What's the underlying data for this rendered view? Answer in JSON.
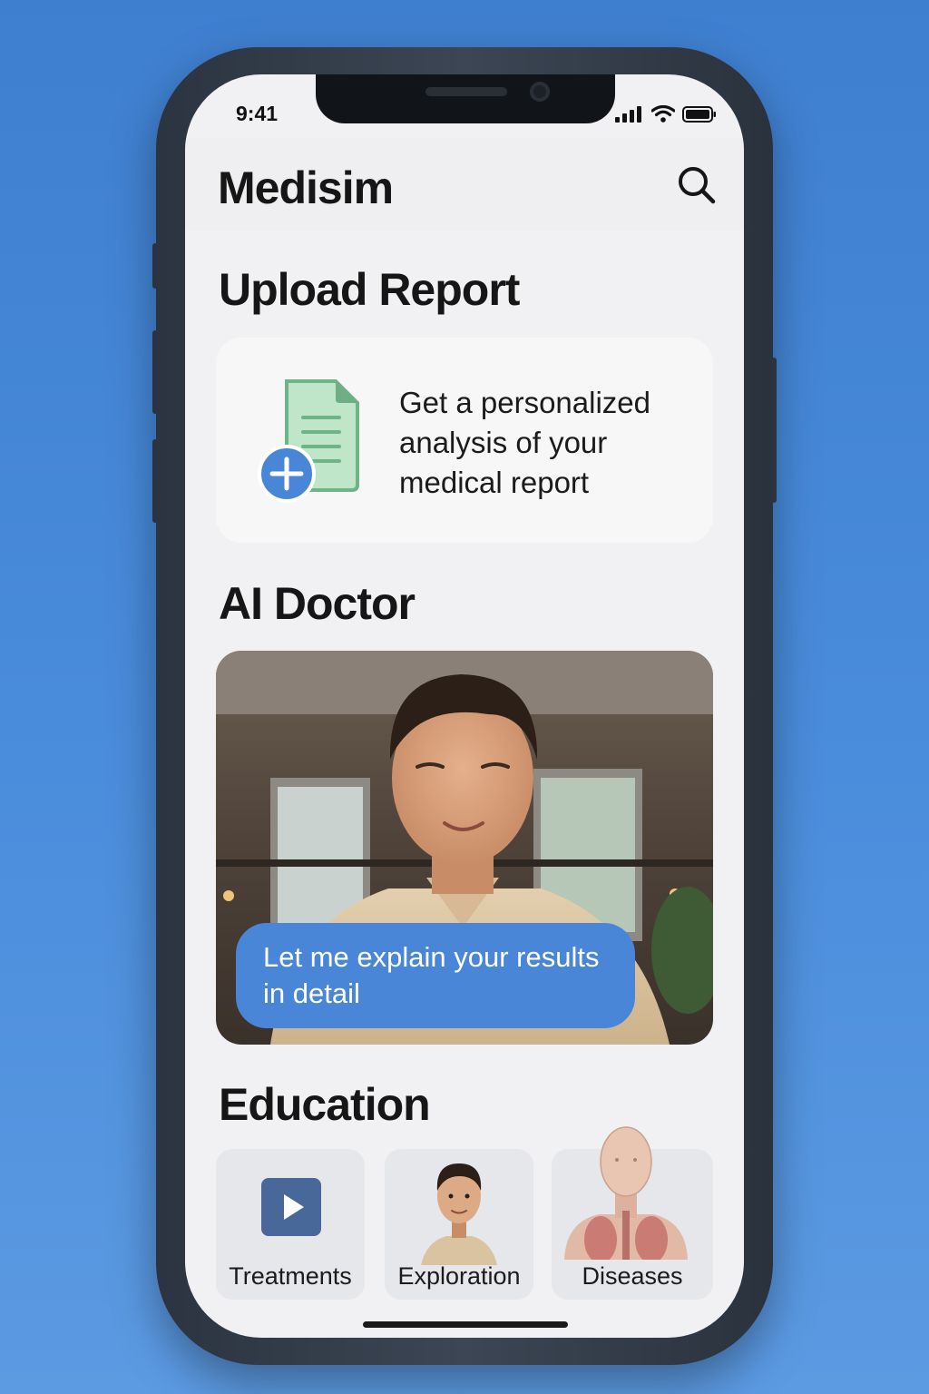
{
  "status_bar": {
    "time": "9:41"
  },
  "header": {
    "app_title": "Medisim",
    "search_icon": "search-icon"
  },
  "upload_section": {
    "title": "Upload Report",
    "card_text": "Get a personalized analysis of your medical report",
    "icon": "document-add-icon"
  },
  "ai_doctor_section": {
    "title": "AI Doctor",
    "speech_bubble": "Let me explain your results in detail"
  },
  "education_section": {
    "title": "Education",
    "items": [
      {
        "label": "Treatments",
        "icon": "play-icon"
      },
      {
        "label": "Exploration",
        "icon": "person-portrait"
      },
      {
        "label": "Diseases",
        "icon": "anatomy-figure"
      }
    ]
  },
  "colors": {
    "background": "#4a8ddc",
    "accent_blue": "#4a86d8",
    "document_green": "#8fd0a4",
    "screen_bg": "#f1f1f3"
  }
}
